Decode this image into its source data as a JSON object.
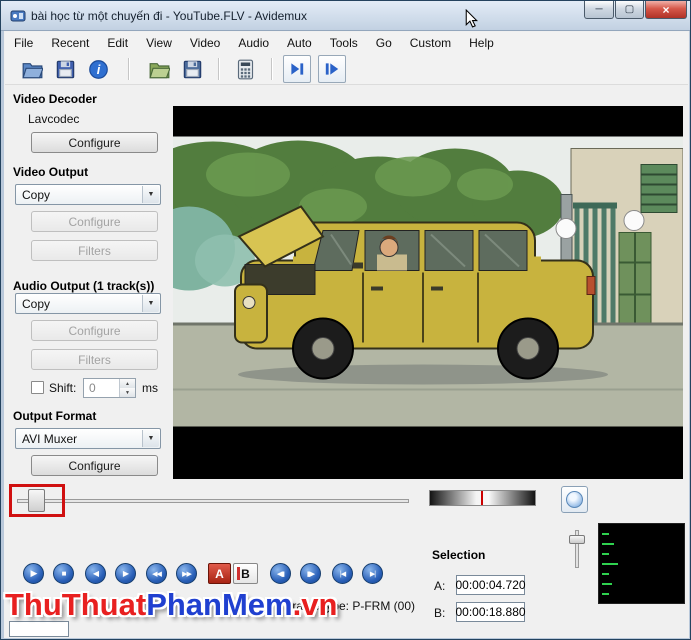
{
  "window": {
    "title": "bài học từ một chuyến đi - YouTube.FLV - Avidemux",
    "minimize": "─",
    "maximize": "▢",
    "close": "×"
  },
  "menu": {
    "items": [
      "File",
      "Recent",
      "Edit",
      "View",
      "Video",
      "Audio",
      "Auto",
      "Tools",
      "Go",
      "Custom",
      "Help"
    ]
  },
  "toolbar": {
    "icons": [
      "open",
      "save",
      "information",
      "open-folder",
      "save-copy",
      "calculator",
      "jump-to-start",
      "jump-to-end"
    ]
  },
  "sidebar": {
    "video_decoder": {
      "title": "Video Decoder",
      "codec": "Lavcodec",
      "configure": "Configure"
    },
    "video_output": {
      "title": "Video Output",
      "selected": "Copy",
      "configure": "Configure",
      "filters": "Filters"
    },
    "audio_output": {
      "title": "Audio Output (1 track(s))",
      "selected": "Copy",
      "configure": "Configure",
      "filters": "Filters",
      "shift_label": "Shift:",
      "shift_value": "0",
      "shift_unit": "ms"
    },
    "output_format": {
      "title": "Output Format",
      "selected": "AVI Muxer",
      "configure": "Configure"
    }
  },
  "transport": {
    "play": "▶",
    "stop": "■",
    "prev_frame": "◀",
    "next_frame": "▶",
    "prev_keyframe": "◀◀",
    "next_keyframe": "▶▶",
    "mark_a": "A",
    "mark_b": "B",
    "prev_black": "◀▮",
    "next_black": "▮▶",
    "first_frame": "|◀",
    "last_frame": "▶|",
    "combo_arrow": "▼",
    "spin_up": "▲",
    "spin_down": "▼"
  },
  "selection": {
    "title": "Selection",
    "a_label": "A:",
    "a_value": "00:00:04.720",
    "b_label": "B:",
    "b_value": "00:00:18.880"
  },
  "status": {
    "frame_type": "Frame type: P-FRM (00)"
  },
  "watermark": {
    "part1": "ThuThuat",
    "part2": "PhanMem",
    "part3": ".vn"
  },
  "colors": {
    "close_button": "#c8443a",
    "transport_blue": "#2a60b8",
    "mark_a_red": "#c03020",
    "annotation_red": "#d01010",
    "watermark_red": "#e82020",
    "watermark_blue": "#2040d0",
    "meter_green": "#2fd24f"
  }
}
